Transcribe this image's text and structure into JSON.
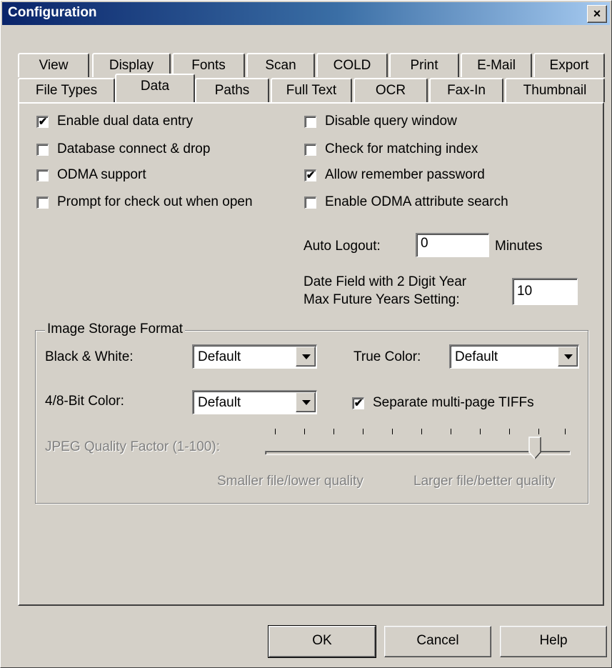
{
  "window": {
    "title": "Configuration",
    "close_glyph": "×"
  },
  "tabs_row1": [
    "View",
    "Display",
    "Fonts",
    "Scan",
    "COLD",
    "Print",
    "E-Mail",
    "Export"
  ],
  "tabs_row2": [
    "File Types",
    "Data",
    "Paths",
    "Full Text",
    "OCR",
    "Fax-In",
    "Thumbnail"
  ],
  "active_tab": "Data",
  "checkboxes_left": [
    {
      "label": "Enable dual data entry",
      "checked": true
    },
    {
      "label": "Database connect & drop",
      "checked": false
    },
    {
      "label": "ODMA support",
      "checked": false
    },
    {
      "label": "Prompt for check out when open",
      "checked": false
    }
  ],
  "checkboxes_right": [
    {
      "label": "Disable query window",
      "checked": false
    },
    {
      "label": "Check for matching index",
      "checked": false
    },
    {
      "label": "Allow remember password",
      "checked": true
    },
    {
      "label": "Enable ODMA attribute search",
      "checked": false
    }
  ],
  "auto_logout": {
    "label": "Auto Logout:",
    "value": "0",
    "unit": "Minutes"
  },
  "date_field": {
    "label_line1": "Date Field with 2 Digit Year",
    "label_line2": "Max Future Years Setting:",
    "value": "10"
  },
  "image_storage": {
    "title": "Image Storage Format",
    "bw_label": "Black & White:",
    "bw_value": "Default",
    "true_color_label": "True Color:",
    "true_color_value": "Default",
    "color48_label": "4/8-Bit Color:",
    "color48_value": "Default",
    "separate_tiffs": {
      "label": "Separate multi-page TIFFs",
      "checked": true
    },
    "jpeg_label": "JPEG Quality Factor (1-100):",
    "jpeg_value_fraction": 0.9,
    "slider_left_caption": "Smaller file/lower quality",
    "slider_right_caption": "Larger file/better quality"
  },
  "buttons": {
    "ok": "OK",
    "cancel": "Cancel",
    "help": "Help"
  },
  "icons": {
    "check": "checkmark-icon",
    "close": "close-icon",
    "dropdown": "chevron-down-icon"
  }
}
